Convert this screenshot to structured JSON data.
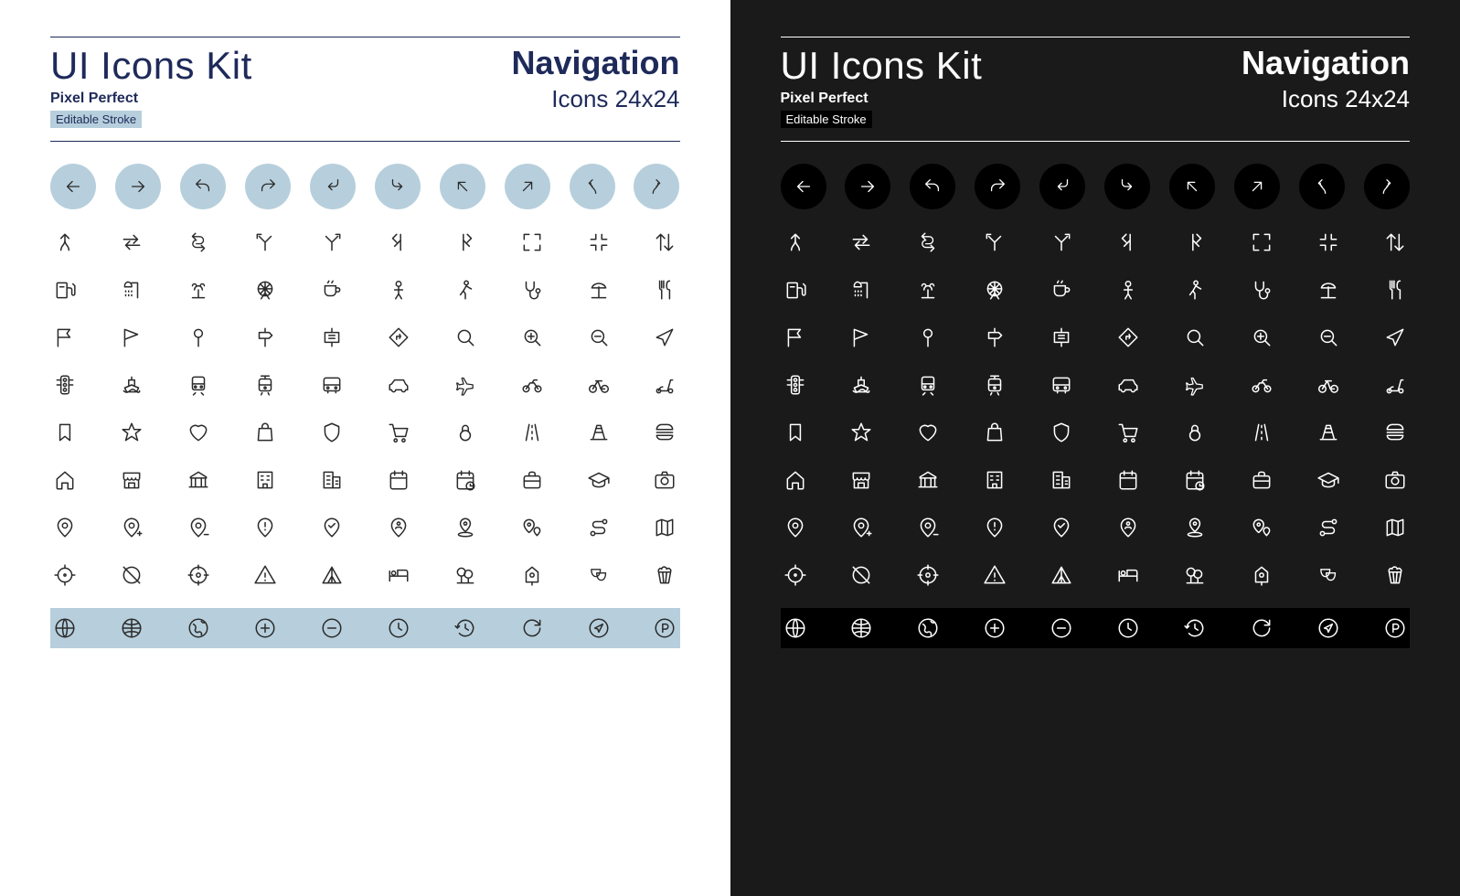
{
  "header": {
    "kit_title": "UI Icons Kit",
    "pixel_perfect": "Pixel Perfect",
    "editable": "Editable Stroke",
    "category": "Navigation",
    "size_label": "Icons 24x24"
  },
  "themes": [
    "light",
    "dark"
  ],
  "rows": [
    {
      "type": "circles",
      "icons": [
        "arrow-left",
        "arrow-right",
        "undo",
        "redo",
        "turn-left",
        "turn-right",
        "arrow-up-left",
        "arrow-up-right",
        "curve-left",
        "curve-right"
      ]
    },
    {
      "type": "plain",
      "icons": [
        "merge",
        "swap-right",
        "s-curve",
        "fork-left",
        "fork-right",
        "branch-left",
        "branch-right",
        "expand",
        "collapse",
        "sort-vertical"
      ]
    },
    {
      "type": "plain",
      "icons": [
        "gas-station",
        "shower",
        "fountain",
        "ferris-wheel",
        "cafe",
        "person",
        "walking",
        "stethoscope",
        "beach-umbrella",
        "restaurant"
      ]
    },
    {
      "type": "plain",
      "icons": [
        "flag-filled",
        "flag-outline",
        "pin",
        "signpost",
        "signboard",
        "turn-sign",
        "search",
        "zoom-in",
        "zoom-out",
        "navigate-arrow"
      ]
    },
    {
      "type": "plain",
      "icons": [
        "traffic-light",
        "ship",
        "train",
        "tram",
        "bus",
        "car",
        "airplane",
        "motorcycle",
        "bicycle",
        "scooter"
      ]
    },
    {
      "type": "plain",
      "icons": [
        "bookmark",
        "star",
        "heart",
        "shopping-bag",
        "shield",
        "shopping-cart",
        "kettlebell",
        "road",
        "traffic-cone",
        "burger"
      ]
    },
    {
      "type": "plain",
      "icons": [
        "home",
        "storefront",
        "bank",
        "apartment",
        "office-building",
        "calendar",
        "calendar-clock",
        "briefcase",
        "graduation-cap",
        "camera"
      ]
    },
    {
      "type": "plain",
      "icons": [
        "map-pin",
        "map-pin-add",
        "map-pin-remove",
        "map-pin-alert",
        "map-pin-check",
        "map-pin-person",
        "map-pin-area",
        "map-pin-multiple",
        "route",
        "map"
      ]
    },
    {
      "type": "plain",
      "icons": [
        "target",
        "compass-off",
        "crosshair",
        "warning-triangle",
        "tent",
        "bed",
        "park",
        "birdhouse",
        "theater-masks",
        "popcorn"
      ]
    },
    {
      "type": "hl",
      "icons": [
        "globe",
        "globe-grid",
        "globe-region",
        "plus-circle",
        "minus-circle",
        "clock",
        "history",
        "refresh",
        "send-circle",
        "parking"
      ]
    }
  ]
}
